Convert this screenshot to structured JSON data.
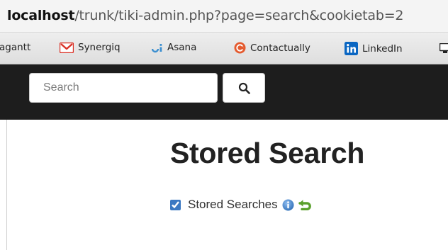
{
  "browser": {
    "url_host": "localhost",
    "url_path": "/trunk/tiki-admin.php?page=search&cookietab=2"
  },
  "bookmarks": [
    {
      "label": "agantt",
      "icon": "none"
    },
    {
      "label": "Synergiq",
      "icon": "gmail-icon"
    },
    {
      "label": "Asana",
      "icon": "asana-icon"
    },
    {
      "label": "Contactually",
      "icon": "contactually-icon"
    },
    {
      "label": "LinkedIn",
      "icon": "linkedin-icon"
    }
  ],
  "colors": {
    "gmail_red": "#d93025",
    "asana_blue": "#3c8fd0",
    "contactually_orange": "#e45a2e",
    "linkedin_blue": "#0a66c2",
    "navbar_bg": "#1d1d1d",
    "info_blue": "#4a8fd6",
    "arrow_green": "#5aa02c"
  },
  "navbar": {
    "search_placeholder": "Search",
    "search_button_icon": "magnifier-icon"
  },
  "main": {
    "title": "Stored Search",
    "preference": {
      "label": "Stored Searches",
      "checked": true,
      "help_icon": "info-icon",
      "reset_icon": "green-arrow-icon"
    }
  }
}
